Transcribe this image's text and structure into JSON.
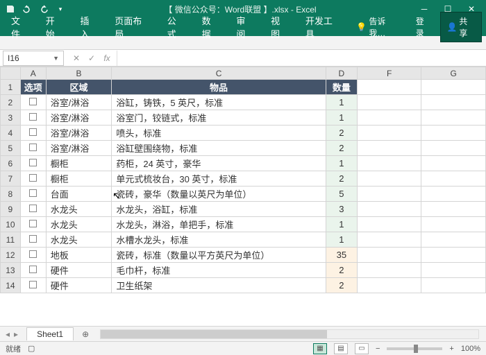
{
  "window": {
    "title": "【 微信公众号：Word联盟 】.xlsx - Excel"
  },
  "ribbon": {
    "tabs": [
      "文件",
      "开始",
      "插入",
      "页面布局",
      "公式",
      "数据",
      "审阅",
      "视图",
      "开发工具"
    ],
    "tell_me": "告诉我…",
    "login": "登录",
    "share": "共享"
  },
  "formula": {
    "name_box": "I16",
    "fx_label": "fx",
    "value": ""
  },
  "columns": [
    "A",
    "B",
    "C",
    "D",
    "F",
    "G"
  ],
  "header_row": {
    "A": "选项",
    "B": "区域",
    "C": "物品",
    "D": "数量"
  },
  "rows": [
    {
      "n": 2,
      "B": "浴室/淋浴",
      "C": "浴缸，铸铁，5 英尺，标准",
      "D": "1",
      "tone": "g"
    },
    {
      "n": 3,
      "B": "浴室/淋浴",
      "C": "浴室门，铰链式，标准",
      "D": "1",
      "tone": "g"
    },
    {
      "n": 4,
      "B": "浴室/淋浴",
      "C": "喷头，标准",
      "D": "2",
      "tone": "g"
    },
    {
      "n": 5,
      "B": "浴室/淋浴",
      "C": "浴缸壁围绕物，标准",
      "D": "2",
      "tone": "g"
    },
    {
      "n": 6,
      "B": "橱柜",
      "C": "药柜，24 英寸，豪华",
      "D": "1",
      "tone": "g"
    },
    {
      "n": 7,
      "B": "橱柜",
      "C": "单元式梳妆台，30 英寸，标准",
      "D": "2",
      "tone": "g"
    },
    {
      "n": 8,
      "B": "台面",
      "C": "瓷砖，豪华（数量以英尺为单位）",
      "D": "5",
      "tone": "g"
    },
    {
      "n": 9,
      "B": "水龙头",
      "C": "水龙头，浴缸，标准",
      "D": "3",
      "tone": "g"
    },
    {
      "n": 10,
      "B": "水龙头",
      "C": "水龙头，淋浴，单把手，标准",
      "D": "1",
      "tone": "g"
    },
    {
      "n": 11,
      "B": "水龙头",
      "C": "水槽水龙头，标准",
      "D": "1",
      "tone": "g"
    },
    {
      "n": 12,
      "B": "地板",
      "C": "瓷砖，标准（数量以平方英尺为单位）",
      "D": "35",
      "tone": "o"
    },
    {
      "n": 13,
      "B": "硬件",
      "C": "毛巾杆，标准",
      "D": "2",
      "tone": "o"
    },
    {
      "n": 14,
      "B": "硬件",
      "C": "卫生纸架",
      "D": "2",
      "tone": "o"
    }
  ],
  "sheet_tabs": {
    "active": "Sheet1"
  },
  "status": {
    "ready": "就绪",
    "zoom": "100%"
  }
}
